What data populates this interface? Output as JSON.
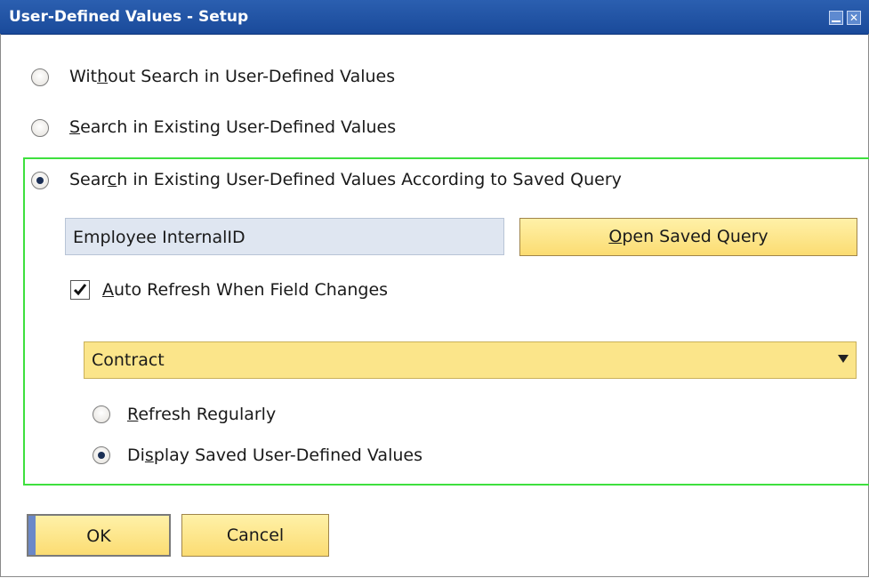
{
  "window": {
    "title": "User-Defined Values - Setup",
    "minimize_icon": "minimize-icon",
    "close_icon": "close-icon"
  },
  "options": [
    {
      "pre": "Wit",
      "mnemonic": "h",
      "post": "out Search in User-Defined Values",
      "checked": false
    },
    {
      "pre": "",
      "mnemonic": "S",
      "post": "earch in Existing User-Defined Values",
      "checked": false
    },
    {
      "pre": "Sear",
      "mnemonic": "c",
      "post": "h in Existing User-Defined Values According to Saved Query",
      "checked": true
    }
  ],
  "query": {
    "field_value": "Employee InternalID",
    "open_button": {
      "pre": "",
      "mnemonic": "O",
      "post": "pen Saved Query"
    }
  },
  "auto_refresh": {
    "pre": "",
    "mnemonic": "A",
    "post": "uto Refresh When Field Changes",
    "checked": true
  },
  "dropdown": {
    "selected": "Contract"
  },
  "refresh_options": [
    {
      "pre": "",
      "mnemonic": "R",
      "post": "efresh Regularly",
      "checked": false
    },
    {
      "pre": "Di",
      "mnemonic": "s",
      "post": "play Saved User-Defined Values",
      "checked": true
    }
  ],
  "footer": {
    "ok_label": "OK",
    "cancel_label": "Cancel"
  },
  "colors": {
    "title_bar": "#1a4a9a",
    "button_yellow": "#fbdc72",
    "field_blue": "#dfe6f1",
    "group_border": "#3ee03e"
  }
}
